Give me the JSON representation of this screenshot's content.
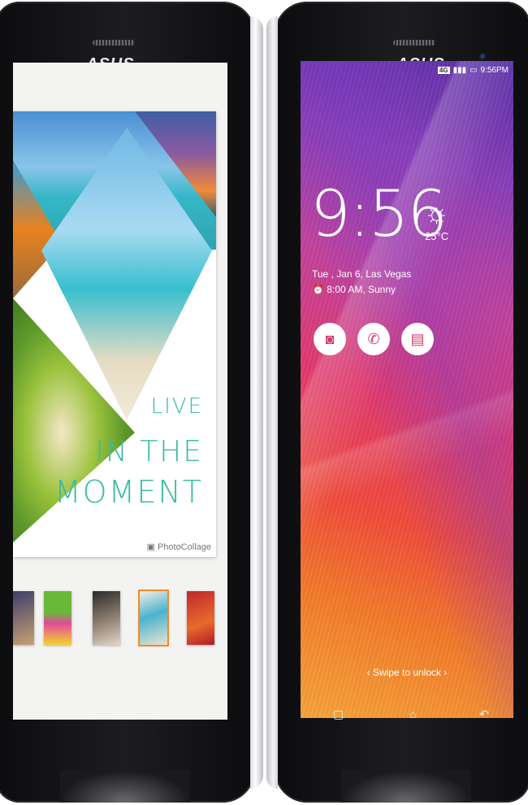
{
  "left_phone": {
    "brand": "ASUS",
    "collage": {
      "line1": "LIVE",
      "line2": "IN THE",
      "line3": "MOMENT",
      "app_logo": "PhotoCollage"
    },
    "thumbnails": [
      "collage-thumb-1",
      "collage-thumb-2",
      "collage-thumb-3",
      "collage-thumb-4",
      "collage-thumb-5"
    ],
    "navbar": {
      "back": "↶",
      "home": "⌂",
      "recent": "▢"
    }
  },
  "right_phone": {
    "brand": "ASUS",
    "status": {
      "network": "4G",
      "time": "9:56PM"
    },
    "lockscreen": {
      "time": "9:56",
      "temperature": "25°C",
      "weather_icon": "sun-icon",
      "date_location": "Tue , Jan 6, Las Vegas",
      "alarm": "8:00 AM, Sunny",
      "shortcuts": [
        "camera-icon",
        "phone-icon",
        "message-icon"
      ],
      "swipe_hint": "‹ Swipe to unlock ›"
    },
    "navbar": {
      "recent": "▢",
      "home": "⌂",
      "back": "↶"
    }
  }
}
